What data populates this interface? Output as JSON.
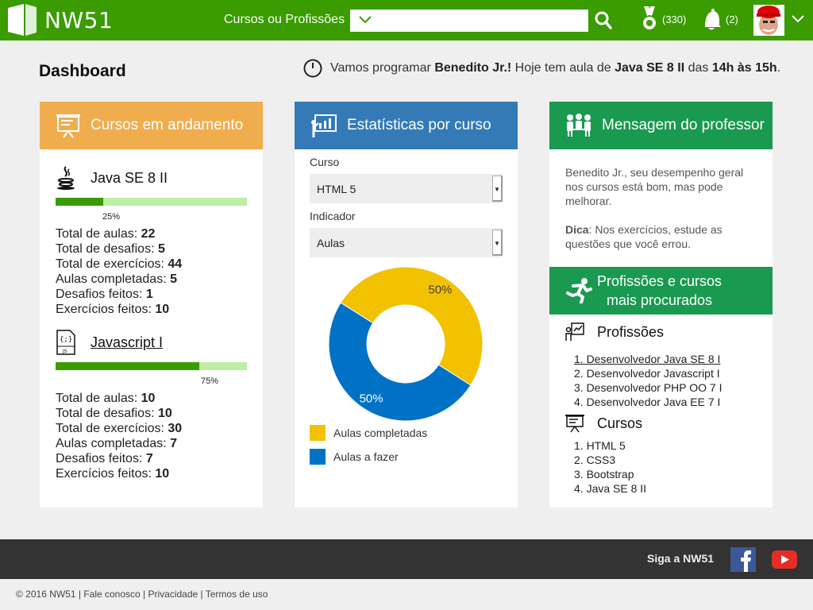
{
  "brand": {
    "name": "NW51"
  },
  "header": {
    "search_label": "Cursos ou Profissões",
    "medals_count": "(330)",
    "notifications_count": "(2)"
  },
  "dashboard": {
    "title": "Dashboard",
    "notice": {
      "prefix": "Vamos programar ",
      "user": "Benedito Jr.!",
      "middle": " Hoje tem aula de ",
      "course": "Java SE 8 II",
      "between": " das ",
      "time": "14h às 15h",
      "end": "."
    }
  },
  "courses_card": {
    "title": "Cursos em andamento",
    "courses": [
      {
        "name": "Java SE 8 II",
        "progress": 0.25,
        "progress_label": "25%",
        "stats": [
          {
            "label": "Total de aulas: ",
            "value": "22"
          },
          {
            "label": "Total de desafios: ",
            "value": "5"
          },
          {
            "label": "Total de exercícios: ",
            "value": "44"
          },
          {
            "label": "Aulas completadas: ",
            "value": "5"
          },
          {
            "label": "Desafios feitos: ",
            "value": "1"
          },
          {
            "label": "Exercícios feitos: ",
            "value": "10"
          }
        ]
      },
      {
        "name": "Javascript I",
        "progress": 0.75,
        "progress_label": "75%",
        "stats": [
          {
            "label": "Total de aulas: ",
            "value": "10"
          },
          {
            "label": "Total de desafios: ",
            "value": "10"
          },
          {
            "label": "Total de exercícios: ",
            "value": "30"
          },
          {
            "label": "Aulas completadas: ",
            "value": "7"
          },
          {
            "label": "Desafios feitos: ",
            "value": "7"
          },
          {
            "label": "Exercícios feitos: ",
            "value": "10"
          }
        ]
      }
    ]
  },
  "stats_card": {
    "title": "Estatísticas por curso",
    "course_label": "Curso",
    "course_value": "HTML 5",
    "indicator_label": "Indicador",
    "indicator_value": "Aulas",
    "chart": {
      "type": "pie",
      "slices": [
        {
          "label": "Aulas completadas",
          "value": 50,
          "text": "50%",
          "color": "#f2c100"
        },
        {
          "label": "Aulas a fazer",
          "value": 50,
          "text": "50%",
          "color": "#0072c6"
        }
      ]
    }
  },
  "message_card": {
    "title": "Mensagem do professor",
    "text": "Benedito Jr., seu desempenho geral nos cursos está bom, mas pode melhorar.",
    "tip_label": "Dica",
    "tip_text": ": Nos exercícios, estude as questões que você errou."
  },
  "popular_card": {
    "title_line1": "Profissões e cursos",
    "title_line2": "mais procurados",
    "professions_title": "Profissões",
    "professions": [
      "1. Desenvolvedor Java SE 8 I",
      "2. Desenvolvedor Javascript I",
      "3. Desenvolvedor PHP OO 7 I",
      "4. Desenvolvedor Java EE 7 I"
    ],
    "courses_title": "Cursos",
    "courses": [
      "1. HTML 5",
      "2. CSS3",
      "3. Bootstrap",
      "4. Java SE 8 II"
    ]
  },
  "footer": {
    "follow": "Siga a NW51",
    "copyright": "© 2016 NW51 | Fale conosco | Privacidade | Termos de uso"
  },
  "icons": {
    "logo": "nw51-logo-icon",
    "search": "search-icon",
    "medal": "medal-icon",
    "bell": "bell-icon",
    "facebook": "facebook-icon",
    "youtube": "youtube-icon"
  },
  "colors": {
    "header_green": "#3a9c00",
    "courses_orange": "#f0ad4e",
    "stats_blue": "#337ab7",
    "message_green": "#1a9950",
    "progress_fill": "#3a9c00",
    "progress_bg": "#bdeea3"
  }
}
